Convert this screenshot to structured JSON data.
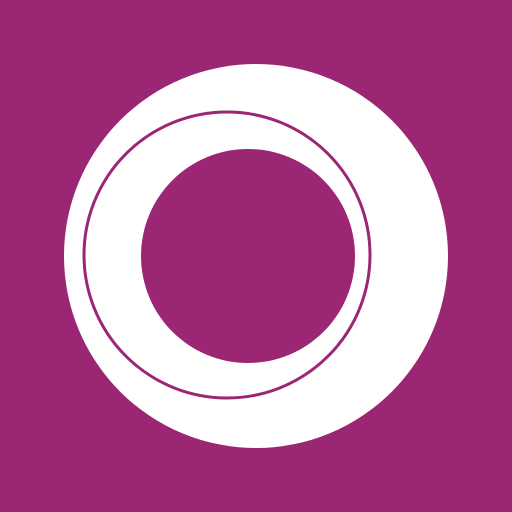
{
  "icon": {
    "name": "ring-logo-icon",
    "colors": {
      "background": "#9b2673",
      "foreground": "#ffffff"
    }
  }
}
